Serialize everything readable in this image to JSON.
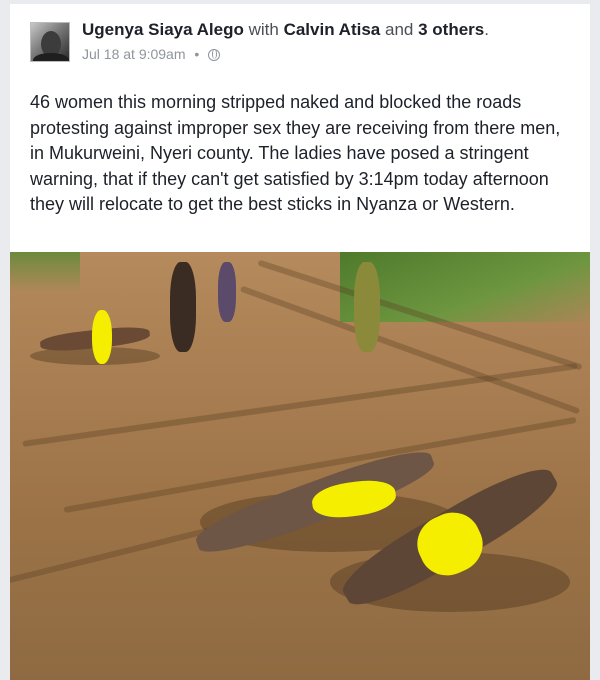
{
  "post": {
    "author": "Ugenya Siaya Alego",
    "with_text": "with",
    "tagged": "Calvin Atisa",
    "and_text": "and",
    "others": "3 others",
    "period": ".",
    "timestamp": "Jul 18 at 9:09am",
    "separator": "•",
    "privacy_icon": "globe-icon",
    "body": "46 women this morning stripped naked and blocked the roads protesting against improper sex they are receiving from there men, in Mukurweini, Nyeri county. The ladies have posed a stringent warning, that if they can't get satisfied by 3:14pm today afternoon they will relocate to get the best sticks in Nyanza or Western."
  },
  "colors": {
    "name": "#1d2129",
    "meta": "#90949c",
    "censor": "#f5ee00",
    "ground": "#a87e52"
  }
}
